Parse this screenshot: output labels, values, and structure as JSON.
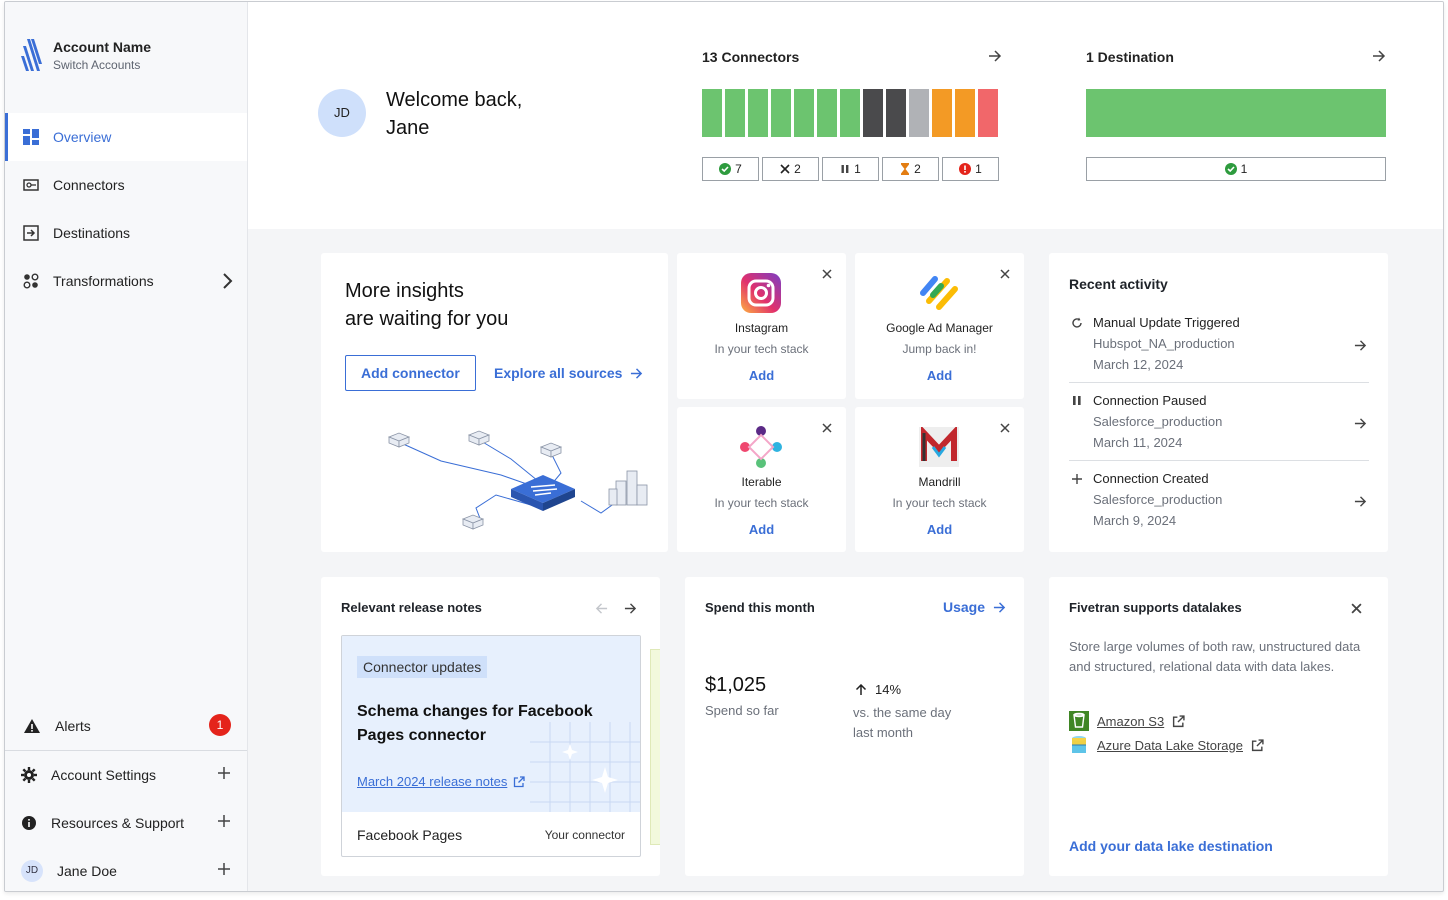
{
  "sidebar": {
    "account_name": "Account Name",
    "switch_label": "Switch Accounts",
    "nav": [
      {
        "label": "Overview"
      },
      {
        "label": "Connectors"
      },
      {
        "label": "Destinations"
      },
      {
        "label": "Transformations"
      }
    ],
    "alerts": {
      "label": "Alerts",
      "count": "1"
    },
    "account_settings": "Account Settings",
    "resources": "Resources & Support",
    "user": {
      "initials": "JD",
      "name": "Jane Doe"
    }
  },
  "header": {
    "avatar_initials": "JD",
    "welcome_line1": "Welcome back,",
    "welcome_line2": "Jane",
    "connectors": {
      "title": "13 Connectors",
      "bar_colors": [
        "#6cc46f",
        "#6cc46f",
        "#6cc46f",
        "#6cc46f",
        "#6cc46f",
        "#6cc46f",
        "#6cc46f",
        "#4a4a4c",
        "#4a4a4c",
        "#b0b2b6",
        "#f39a25",
        "#f39a25",
        "#f1676a"
      ],
      "stats": [
        {
          "icon": "check-circle-icon",
          "value": "7"
        },
        {
          "icon": "x-icon",
          "value": "2"
        },
        {
          "icon": "pause-icon",
          "value": "1"
        },
        {
          "icon": "hourglass-icon",
          "value": "2"
        },
        {
          "icon": "error-icon",
          "value": "1"
        }
      ]
    },
    "destination": {
      "title": "1 Destination",
      "count": "1"
    }
  },
  "insights": {
    "title_line1": "More insights",
    "title_line2": "are waiting for you",
    "add_connector": "Add connector",
    "explore": "Explore all sources"
  },
  "sources": [
    {
      "name": "Instagram",
      "sub": "In your tech stack",
      "add": "Add"
    },
    {
      "name": "Google Ad Manager",
      "sub": "Jump back in!",
      "add": "Add"
    },
    {
      "name": "Iterable",
      "sub": "In your tech stack",
      "add": "Add"
    },
    {
      "name": "Mandrill",
      "sub": "In your tech stack",
      "add": "Add"
    }
  ],
  "recent": {
    "title": "Recent activity",
    "items": [
      {
        "title": "Manual Update Triggered",
        "source": "Hubspot_NA_production",
        "date": "March 12, 2024"
      },
      {
        "title": "Connection Paused",
        "source": "Salesforce_production",
        "date": "March 11, 2024"
      },
      {
        "title": "Connection Created",
        "source": "Salesforce_production",
        "date": "March 9, 2024"
      }
    ]
  },
  "release": {
    "title": "Relevant release notes",
    "tag": "Connector updates",
    "headline_line1": "Schema changes for Facebook",
    "headline_line2": "Pages connector",
    "link": "March 2024 release notes",
    "footer_left": "Facebook Pages",
    "footer_right": "Your connector"
  },
  "spend": {
    "title": "Spend this month",
    "usage": "Usage",
    "amount": "$1,025",
    "amount_sub": "Spend so far",
    "change": "14%",
    "change_sub1": "vs. the same day",
    "change_sub2": "last month"
  },
  "datalake": {
    "title": "Fivetran supports datalakes",
    "desc": "Store large volumes of both raw, unstructured data and structured, relational data with data lakes.",
    "links": [
      "Amazon S3",
      "Azure Data Lake Storage"
    ],
    "cta": "Add your data lake destination"
  }
}
